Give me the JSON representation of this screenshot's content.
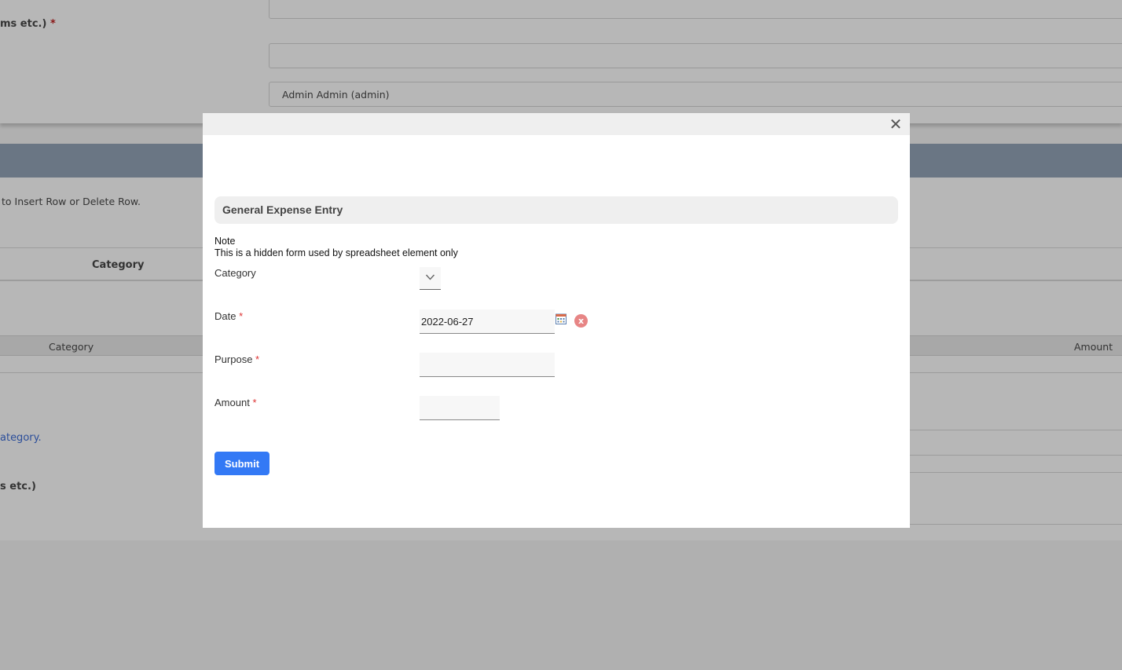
{
  "background": {
    "top_label": "ms etc.)",
    "top_label_required": "*",
    "owner_value": "Admin Admin (admin)",
    "instructions": "to Insert Row or Delete Row.",
    "grid_header_category": "Category",
    "table_header_category": "Category",
    "table_header_amount": "Amount",
    "link_text": "ategory.",
    "bottom_label": "s etc.)"
  },
  "modal": {
    "close_symbol": "✕",
    "form_title": "General Expense Entry",
    "note_title": "Note",
    "note_text": "This is a hidden form used by spreadsheet element only",
    "fields": {
      "category": {
        "label": "Category",
        "value": ""
      },
      "date": {
        "label": "Date",
        "required": "*",
        "value": "2022-06-27",
        "clear_symbol": "x"
      },
      "purpose": {
        "label": "Purpose",
        "required": "*",
        "value": ""
      },
      "amount": {
        "label": "Amount",
        "required": "*",
        "value": ""
      }
    },
    "submit_label": "Submit"
  },
  "colors": {
    "overlay_bg": "#b0b0b0",
    "section_header": "#6a7684",
    "submit_button": "#3379f5",
    "required_star": "#dd3333",
    "clear_icon": "#e78585"
  },
  "icons": [
    "close-icon",
    "chevron-down-icon",
    "calendar-icon",
    "clear-icon"
  ]
}
